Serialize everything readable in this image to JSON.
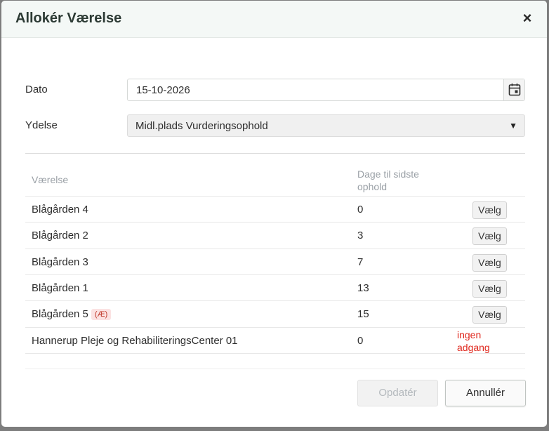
{
  "dialog": {
    "title": "Allokér Værelse",
    "close_icon": "×"
  },
  "form": {
    "date_label": "Dato",
    "date_value": "15-10-2026",
    "service_label": "Ydelse",
    "service_value": "Midl.plads Vurderingsophold",
    "select_arrow": "▼"
  },
  "table": {
    "columns": [
      "Værelse",
      "Dage til sidste ophold"
    ],
    "choose_label": "Vælg",
    "rows": [
      {
        "room": "Blågården 4",
        "days": "0",
        "badge": "",
        "action": "Vælg"
      },
      {
        "room": "Blågården 2",
        "days": "3",
        "badge": "",
        "action": "Vælg"
      },
      {
        "room": "Blågården 3",
        "days": "7",
        "badge": "",
        "action": "Vælg"
      },
      {
        "room": "Blågården 1",
        "days": "13",
        "badge": "",
        "action": "Vælg"
      },
      {
        "room": "Blågården 5",
        "days": "15",
        "badge": "(Æ)",
        "action": "Vælg"
      },
      {
        "room": "Hannerup Pleje og RehabiliteringsCenter 01",
        "days": "0",
        "badge": "",
        "action": "",
        "no_access": "ingen adgang"
      }
    ]
  },
  "footer": {
    "update_label": "Opdatér",
    "cancel_label": "Annullér"
  },
  "icons": {
    "calendar": "calendar-icon",
    "close": "close-icon",
    "dropdown": "chevron-down-icon"
  },
  "colors": {
    "header_bg": "#f4f8f6",
    "no_access": "#e0281e",
    "badge_bg": "#fbe2e2",
    "badge_text": "#c0392b"
  }
}
